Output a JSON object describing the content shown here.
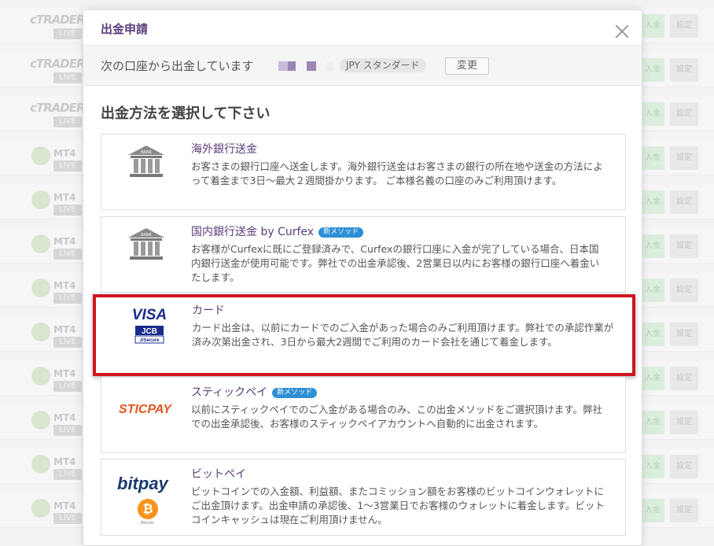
{
  "background": {
    "rows": [
      {
        "brand": "cTRADER",
        "platform": "",
        "tag": "LIVE",
        "deposit": "入金",
        "settings": "設定"
      },
      {
        "brand": "cTRADER",
        "platform": "",
        "tag": "LIVE",
        "deposit": "入金",
        "settings": "設定"
      },
      {
        "brand": "cTRADER",
        "platform": "",
        "tag": "LIVE",
        "deposit": "入金",
        "settings": "設定"
      },
      {
        "brand": "",
        "platform": "MT4",
        "tag": "LIVE",
        "deposit": "入金",
        "settings": "設定"
      },
      {
        "brand": "",
        "platform": "MT4",
        "tag": "LIVE",
        "deposit": "入金",
        "settings": "設定"
      },
      {
        "brand": "",
        "platform": "MT4",
        "tag": "LIVE",
        "deposit": "入金",
        "settings": "設定"
      },
      {
        "brand": "",
        "platform": "MT4",
        "tag": "LIVE",
        "deposit": "入金",
        "settings": "設定"
      },
      {
        "brand": "",
        "platform": "MT4",
        "tag": "LIVE",
        "deposit": "入金",
        "settings": "設定"
      },
      {
        "brand": "",
        "platform": "MT4",
        "tag": "LIVE",
        "deposit": "入金",
        "settings": "設定"
      },
      {
        "brand": "",
        "platform": "MT4",
        "tag": "LIVE",
        "deposit": "入金",
        "settings": "設定"
      },
      {
        "brand": "",
        "platform": "MT4",
        "tag": "LIVE",
        "deposit": "入金",
        "settings": "設定"
      },
      {
        "brand": "",
        "platform": "MT4",
        "tag": "LIVE",
        "deposit": "入金",
        "settings": "設定"
      }
    ]
  },
  "modal": {
    "title": "出金申請",
    "account_label": "次の口座から出金しています",
    "account_type": "JPY スタンダード",
    "change_button": "変更",
    "section_title": "出金方法を選択して下さい",
    "methods": [
      {
        "name": "海外銀行送金",
        "badge": "",
        "icon": "bank-icon",
        "selected": false,
        "desc": "お客さまの銀行口座へ送金します。海外銀行送金はお客さまの銀行の所在地や送金の方法によって着金まで3日〜最大２週間掛かります。 ご本様名義の口座のみご利用頂けます。"
      },
      {
        "name": "国内銀行送金 by Curfex",
        "badge": "新メソッド",
        "icon": "bank-icon",
        "selected": false,
        "desc": "お客様がCurfexに既にご登録済みで、Curfexの銀行口座に入金が完了している場合、日本国内銀行送金が使用可能です。弊社での出金承認後、2営業日以内にお客様の銀行口座へ着金いたします。"
      },
      {
        "name": "カード",
        "badge": "",
        "icon": "visa-jcb-icon",
        "selected": true,
        "desc": "カード出金は、以前にカードでのご入金があった場合のみご利用頂けます。弊社での承認作業が済み次第出金され、3日から最大2週間でご利用のカード会社を通じて着金します。"
      },
      {
        "name": "スティックペイ",
        "badge": "新メソッド",
        "icon": "sticpay-logo",
        "selected": false,
        "desc": "以前にスティックペイでのご入金がある場合のみ、この出金メソッドをご選択頂けます。弊社での出金承認後、お客様のスティックペイアカウントへ自動的に出金されます。"
      },
      {
        "name": "ビットペイ",
        "badge": "",
        "icon": "bitpay-logo",
        "selected": false,
        "desc": "ビットコインでの入金額、利益額、またコミッション額をお客様のビットコインウォレットにご出金頂けます。出金申請の承認後、1〜3営業日でお客様のウォレットに着金します。ビットコインキャッシュは現在ご利用頂けません。"
      }
    ],
    "logos": {
      "bank": "BANK",
      "visa": "VISA",
      "jcb": "JCB",
      "jsecure": "J/Secure",
      "sticpay": "STICPAY",
      "bitpay": "bitpay",
      "bitcoin": "Bitcoin"
    }
  },
  "colors": {
    "accent_purple": "#5a3d7a",
    "selection_red": "#d0141f",
    "badge_blue": "#2d8fd5"
  }
}
